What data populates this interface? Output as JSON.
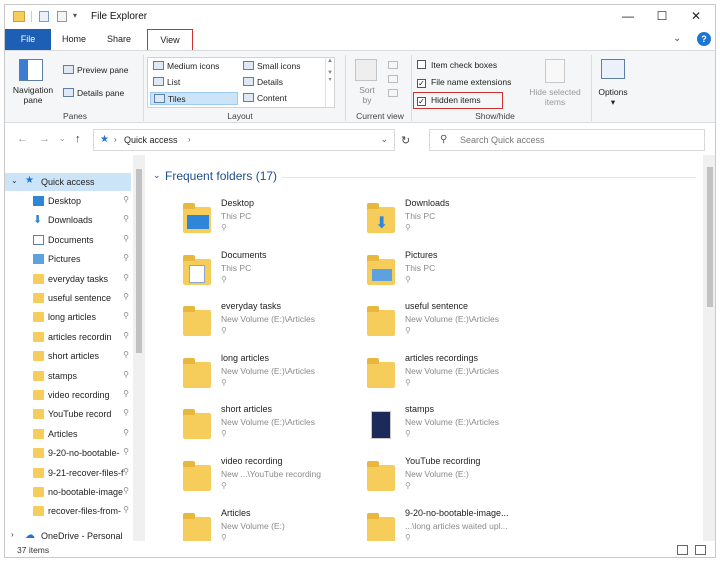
{
  "window": {
    "title": "File Explorer",
    "minimize_icon": "minimize-icon",
    "maximize_icon": "maximize-icon",
    "close_icon": "close-icon"
  },
  "tabs": {
    "file": "File",
    "home": "Home",
    "share": "Share",
    "view": "View",
    "view_highlight_color": "#d0312d"
  },
  "ribbon": {
    "panes": {
      "navigation_pane": "Navigation pane",
      "preview_pane": "Preview pane",
      "details_pane": "Details pane",
      "label": "Panes"
    },
    "layout": {
      "items": [
        "Medium icons",
        "Small icons",
        "List",
        "Details",
        "Tiles",
        "Content"
      ],
      "selected": "Tiles",
      "label": "Layout"
    },
    "current_view": {
      "sort_by": "Sort by",
      "label": "Current view"
    },
    "show_hide": {
      "item_check_boxes": "Item check boxes",
      "item_check_boxes_checked": false,
      "file_name_extensions": "File name extensions",
      "file_name_extensions_checked": true,
      "hidden_items": "Hidden items",
      "hidden_items_checked": true,
      "hide_selected_items": "Hide selected items",
      "label": "Show/hide"
    },
    "options": "Options"
  },
  "address": {
    "path": "Quick access",
    "search_placeholder": "Search Quick access"
  },
  "nav": {
    "quick_access": "Quick access",
    "items": [
      {
        "label": "Desktop",
        "icon": "desktop-icon"
      },
      {
        "label": "Downloads",
        "icon": "downloads-icon"
      },
      {
        "label": "Documents",
        "icon": "documents-icon"
      },
      {
        "label": "Pictures",
        "icon": "pictures-icon"
      },
      {
        "label": "everyday tasks",
        "icon": "folder-icon"
      },
      {
        "label": "useful sentence",
        "icon": "folder-icon"
      },
      {
        "label": "long articles",
        "icon": "folder-icon"
      },
      {
        "label": "articles recordin",
        "icon": "folder-icon"
      },
      {
        "label": "short articles",
        "icon": "folder-icon"
      },
      {
        "label": "stamps",
        "icon": "folder-icon"
      },
      {
        "label": "video recording",
        "icon": "folder-icon"
      },
      {
        "label": "YouTube record",
        "icon": "folder-icon"
      },
      {
        "label": "Articles",
        "icon": "folder-icon"
      },
      {
        "label": "9-20-no-bootable-",
        "icon": "folder-icon"
      },
      {
        "label": "9-21-recover-files-f",
        "icon": "folder-icon"
      },
      {
        "label": "no-bootable-image",
        "icon": "folder-icon"
      },
      {
        "label": "recover-files-from-",
        "icon": "folder-icon"
      }
    ],
    "onedrive": "OneDrive - Personal"
  },
  "content": {
    "section_title": "Frequent folders (17)",
    "folders": [
      {
        "name": "Desktop",
        "location": "This PC"
      },
      {
        "name": "Downloads",
        "location": "This PC"
      },
      {
        "name": "Documents",
        "location": "This PC"
      },
      {
        "name": "Pictures",
        "location": "This PC"
      },
      {
        "name": "everyday tasks",
        "location": "New Volume (E:)\\Articles"
      },
      {
        "name": "useful sentence",
        "location": "New Volume (E:)\\Articles"
      },
      {
        "name": "long articles",
        "location": "New Volume (E:)\\Articles"
      },
      {
        "name": "articles recordings",
        "location": "New Volume (E:)\\Articles"
      },
      {
        "name": "short articles",
        "location": "New Volume (E:)\\Articles"
      },
      {
        "name": "stamps",
        "location": "New Volume (E:)\\Articles"
      },
      {
        "name": "video recording",
        "location": "New ...\\YouTube recording"
      },
      {
        "name": "YouTube recording",
        "location": "New Volume (E:)"
      },
      {
        "name": "Articles",
        "location": "New Volume (E:)"
      },
      {
        "name": "9-20-no-bootable-image...",
        "location": "...\\long articles waited upl..."
      }
    ]
  },
  "status": {
    "items_count": "37 items"
  }
}
